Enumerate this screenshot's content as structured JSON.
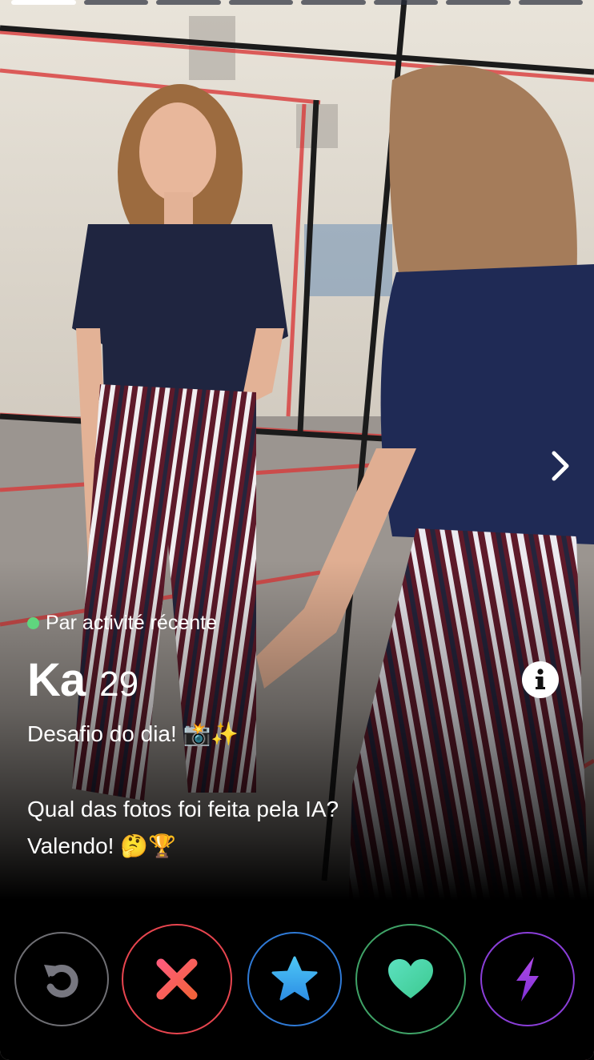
{
  "progress": {
    "total": 8,
    "current": 1
  },
  "profile": {
    "status": "Par activité récente",
    "name": "Ka",
    "age": "29",
    "bio_line1": "Desafio do dia! 📸✨",
    "bio_line2": "Qual das fotos foi feita pela IA?",
    "bio_line3": "Valendo! 🤔🏆"
  },
  "icons": {
    "next": "chevron-right-icon",
    "info": "info-icon",
    "rewind": "rewind-icon",
    "nope": "x-icon",
    "super_like": "star-icon",
    "like": "heart-icon",
    "boost": "lightning-icon"
  },
  "colors": {
    "status_dot": "#5fd67e",
    "nope": "#e8454f",
    "super_like": "#2f7ad6",
    "like": "#3fa367",
    "boost": "#8a3ed8",
    "rewind": "#6f6f74"
  }
}
